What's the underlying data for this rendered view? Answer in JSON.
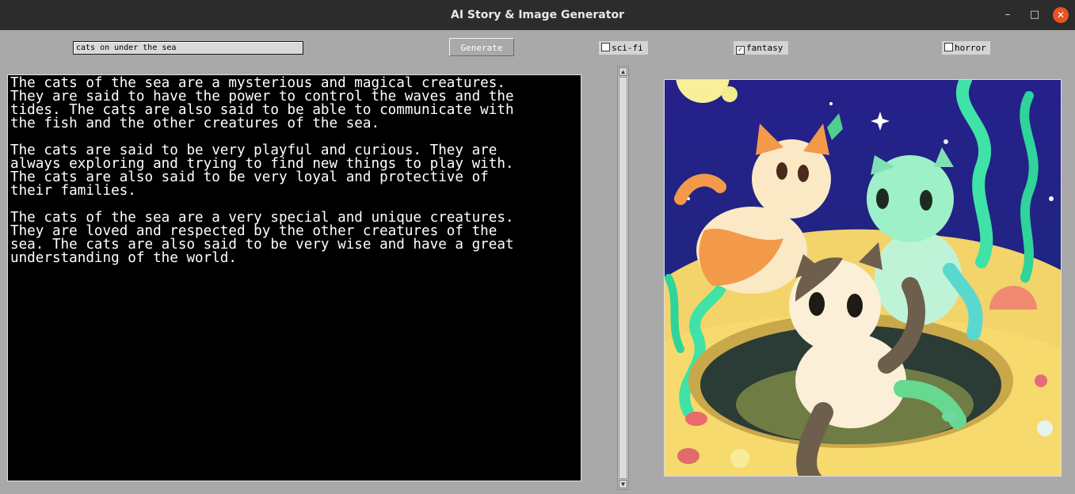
{
  "window": {
    "title": "AI Story & Image Generator",
    "minimize_glyph": "–",
    "maximize_glyph": "□",
    "close_glyph": "✕"
  },
  "controls": {
    "prompt_value": "cats on under the sea",
    "generate_label": "Generate",
    "genres": [
      {
        "label": "sci-fi",
        "checked": false
      },
      {
        "label": "fantasy",
        "checked": true
      },
      {
        "label": "horror",
        "checked": false
      }
    ]
  },
  "story": {
    "paragraphs": [
      "The cats of the sea are a mysterious and magical creatures.\nThey are said to have the power to control the waves and the\ntides. The cats are also said to be able to communicate with\nthe fish and the other creatures of the sea.",
      "The cats are said to be very playful and curious. They are\nalways exploring and trying to find new things to play with.\nThe cats are also said to be very loyal and protective of\ntheir families.",
      "The cats of the sea are a very special and unique creatures.\nThey are loved and respected by the other creatures of the\nsea. The cats are also said to be very wise and have a great\nunderstanding of the world."
    ]
  },
  "scrollbar": {
    "up_glyph": "▲",
    "down_glyph": "▼"
  },
  "image": {
    "subject": "illustration of three cats under the sea",
    "colors": {
      "sky": "#1d2175",
      "sand": "#f3d46a",
      "seaweed": "#3fe3a8",
      "orange_cat": "#f39a4a",
      "green_cat": "#9ef0c8",
      "brown_cat": "#6e5e4c"
    }
  }
}
